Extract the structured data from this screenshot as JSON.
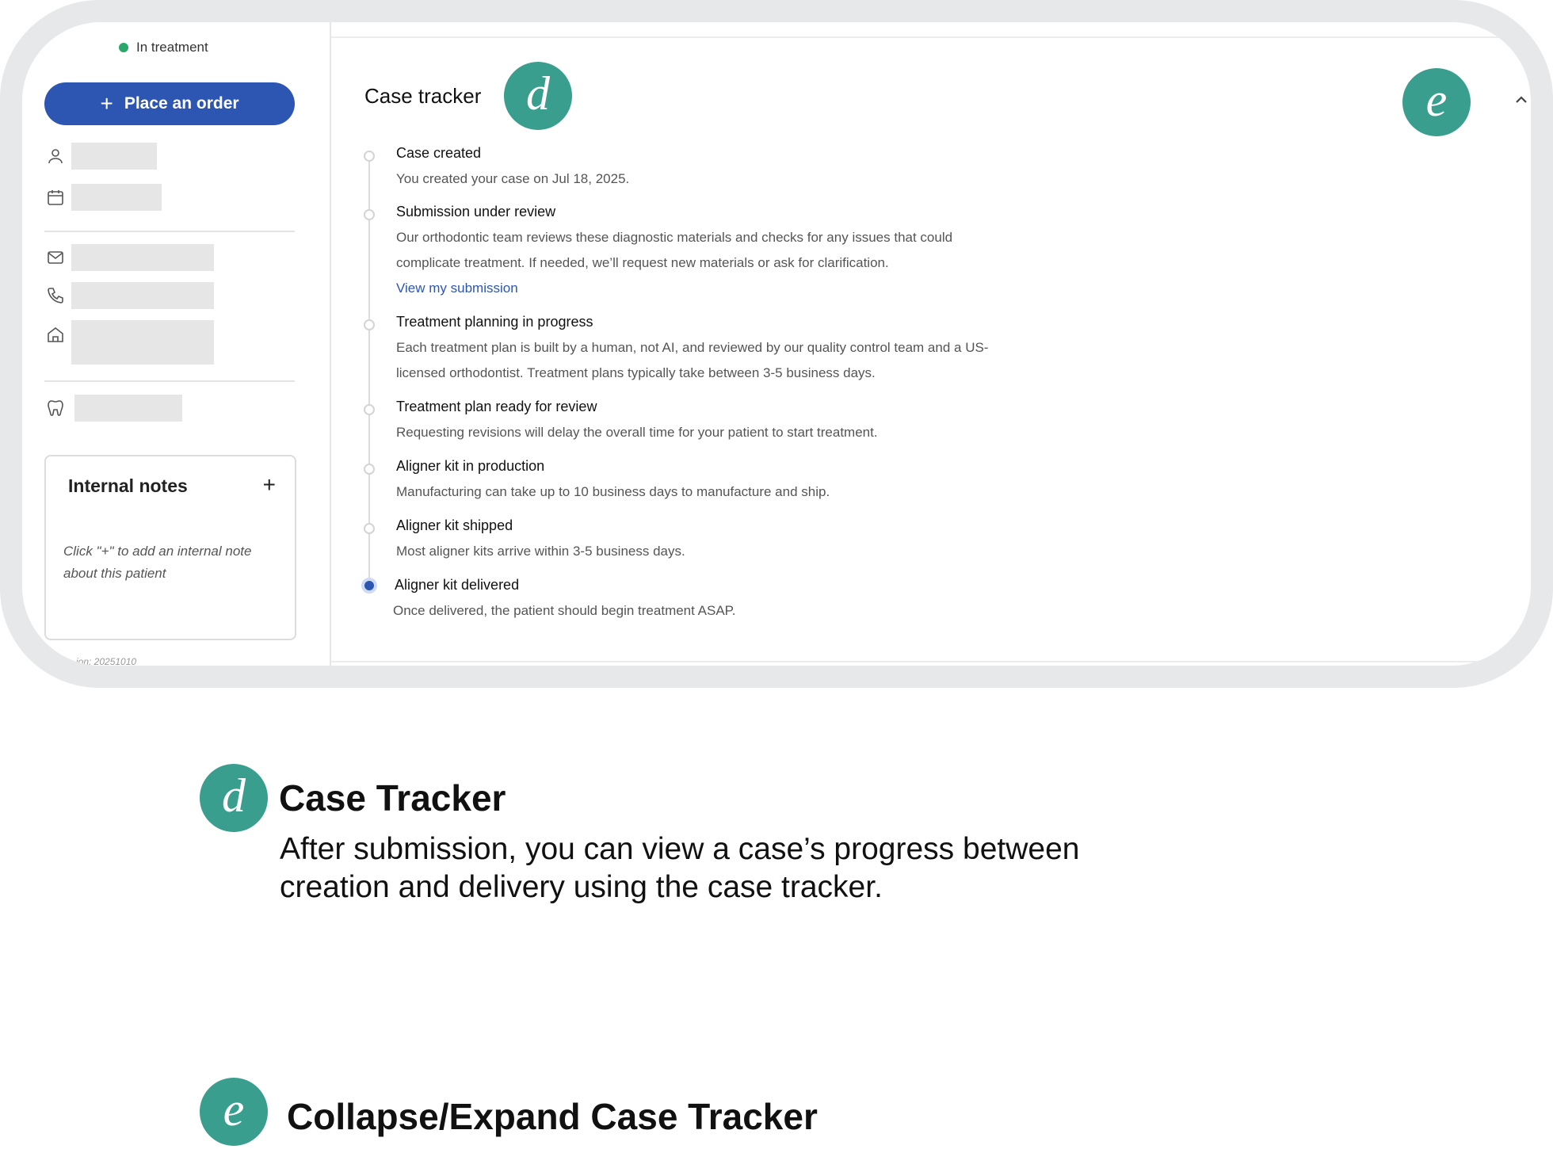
{
  "sidebar": {
    "status": "In treatment",
    "status_color": "#2aa86b",
    "order_button": "Place an order",
    "icons": [
      "person-icon",
      "calendar-icon",
      "mail-icon",
      "phone-icon",
      "home-icon",
      "tooth-icon"
    ],
    "notes": {
      "title": "Internal notes",
      "add": "+",
      "hint": "Click \"+\" to add an internal note about this patient"
    },
    "version": "...ion: 20251010"
  },
  "tracker": {
    "title": "Case tracker",
    "badge_d": "d",
    "badge_e": "e",
    "steps": [
      {
        "title": "Case created",
        "desc1": "You created your case on Jul 18, 2025.",
        "desc2": ""
      },
      {
        "title": "Submission under review",
        "desc1": "Our orthodontic team reviews these diagnostic materials and checks for any issues that could",
        "desc2": "complicate treatment. If needed, we’ll request new materials or ask for clarification.",
        "link": "View my submission"
      },
      {
        "title": "Treatment planning in progress",
        "desc1": "Each treatment plan is built by a human, not AI, and reviewed by our quality control team and a US-",
        "desc2": "licensed orthodontist. Treatment plans typically take between 3-5 business days."
      },
      {
        "title": "Treatment plan ready for review",
        "desc1": "Requesting revisions will delay the overall time for your patient to start treatment.",
        "desc2": ""
      },
      {
        "title": "Aligner kit in production",
        "desc1": "Manufacturing can take up to 10 business days to manufacture and ship.",
        "desc2": ""
      },
      {
        "title": "Aligner kit shipped",
        "desc1": "Most aligner kits arrive within 3-5 business days.",
        "desc2": ""
      },
      {
        "title": "Aligner kit delivered",
        "desc1": "Once delivered, the patient should begin treatment ASAP.",
        "desc2": ""
      }
    ]
  },
  "explain": {
    "d_letter": "d",
    "d_title": "Case Tracker",
    "d_desc": "After submission, you can view a case’s progress between creation and delivery using the case tracker.",
    "e_letter": "e",
    "e_title": "Collapse/Expand Case Tracker"
  },
  "colors": {
    "accent": "#2d56b3",
    "badge": "#3a9e8f"
  }
}
